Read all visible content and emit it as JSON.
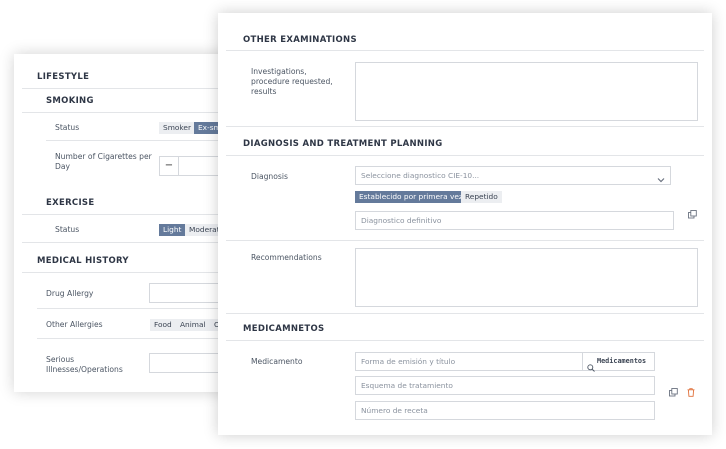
{
  "lifestyle": {
    "title": "LIFESTYLE",
    "smoking": {
      "title": "SMOKING",
      "status_label": "Status",
      "status_options": [
        "Smoker",
        "Ex-sm"
      ],
      "cigarettes_label": "Number of Cigarettes per Day",
      "minus": "−"
    },
    "exercise": {
      "title": "EXERCISE",
      "status_label": "Status",
      "status_options": [
        "Light",
        "Moderat"
      ]
    }
  },
  "medical_history": {
    "title": "MEDICAL HISTORY",
    "drug_allergy_label": "Drug Allergy",
    "other_allergies_label": "Other Allergies",
    "allergy_options": [
      "Food",
      "Animal",
      "O"
    ],
    "serious_label": "Serious Illnesses/Operations"
  },
  "other_examinations": {
    "title": "OTHER EXAMINATIONS",
    "investigations_label": "Investigations, procedure requested, results"
  },
  "diagnosis_planning": {
    "title": "DIAGNOSIS AND TREATMENT PLANNING",
    "diagnosis_label": "Diagnosis",
    "select_placeholder": "Seleccione diagnostico CIE-10...",
    "type_options": [
      "Establecido por primera vez",
      "Repetido"
    ],
    "definitive_placeholder": "Diagnostico definitivo",
    "recommendations_label": "Recommendations"
  },
  "medicamentos": {
    "title": "MEDICAMNETOS",
    "medicamento_label": "Medicamento",
    "form_placeholder": "Forma de emisión y título",
    "button_label": "Medicamentos",
    "scheme_placeholder": "Esquema de tratamiento",
    "recipe_placeholder": "Número de receta"
  },
  "icons": {
    "copy": "copy-icon",
    "trash": "trash-icon",
    "search": "search-icon",
    "chevron": "chevron-down-icon"
  },
  "colors": {
    "selected_tag": "#647a9b",
    "trash": "#e0703a"
  }
}
